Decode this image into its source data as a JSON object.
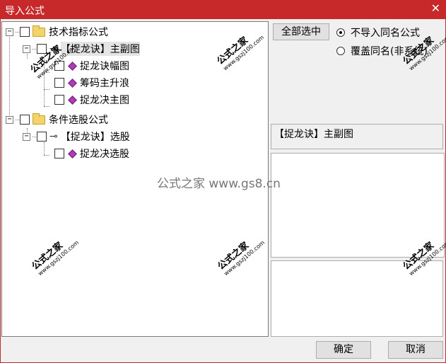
{
  "window": {
    "title": "导入公式"
  },
  "tree": {
    "group1": {
      "label": "技术指标公式",
      "sub": {
        "label": "【捉龙诀】主副图",
        "items": [
          "捉龙诀幅图",
          "筹码主升浪",
          "捉龙决主图"
        ]
      }
    },
    "group2": {
      "label": "条件选股公式",
      "sub": {
        "label": "【捉龙诀】选股",
        "items": [
          "捉龙决选股"
        ]
      }
    }
  },
  "buttons": {
    "select_all": "全部选中",
    "ok": "确定",
    "cancel": "取消"
  },
  "options": {
    "no_import_same": "不导入同名公式",
    "overwrite_same": "覆盖同名(非系统)",
    "selected": "no_import_same"
  },
  "info": {
    "text": "【捉龙诀】主副图"
  },
  "watermarks": {
    "center": "公式之家 www.gs8.cn",
    "stamp_big": "公式之家",
    "stamp_small": "www.gszj100.com"
  }
}
